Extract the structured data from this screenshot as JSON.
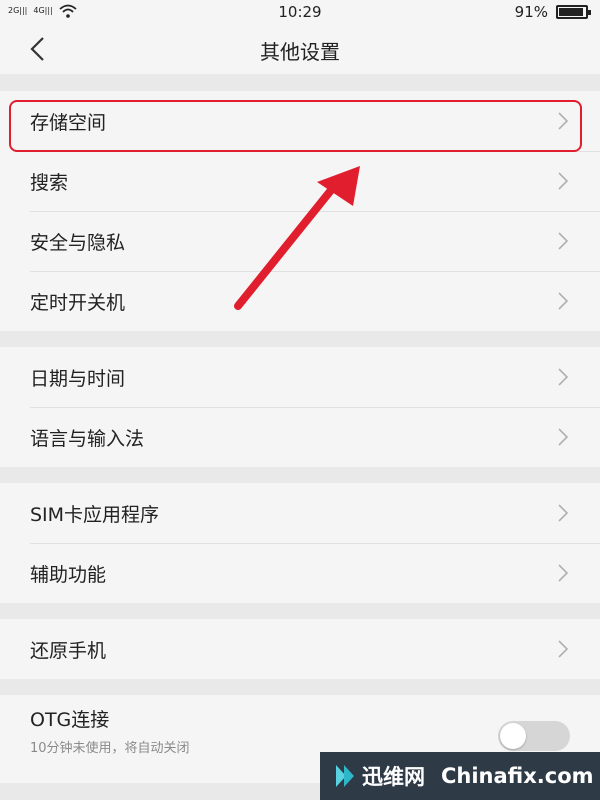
{
  "status_bar": {
    "sim1": "2G|||",
    "sim2": "4G|||",
    "time": "10:29",
    "battery_text": "91%",
    "battery_level": 0.91
  },
  "header": {
    "title": "其他设置"
  },
  "groups": [
    {
      "items": [
        "存储空间",
        "搜索",
        "安全与隐私",
        "定时开关机"
      ]
    },
    {
      "items": [
        "日期与时间",
        "语言与输入法"
      ]
    },
    {
      "items": [
        "SIM卡应用程序",
        "辅助功能"
      ]
    },
    {
      "items": [
        "还原手机"
      ]
    }
  ],
  "otg": {
    "title": "OTG连接",
    "subtitle": "10分钟未使用，将自动关闭",
    "enabled": false
  },
  "watermark": {
    "cn": "迅维网",
    "en": "Chinafix.com"
  },
  "colors": {
    "highlight": "#e01e2d",
    "arrow": "#e01e2d"
  },
  "icons": [
    "back-arrow-icon",
    "chevron-right-icon",
    "wifi-icon",
    "battery-icon"
  ]
}
